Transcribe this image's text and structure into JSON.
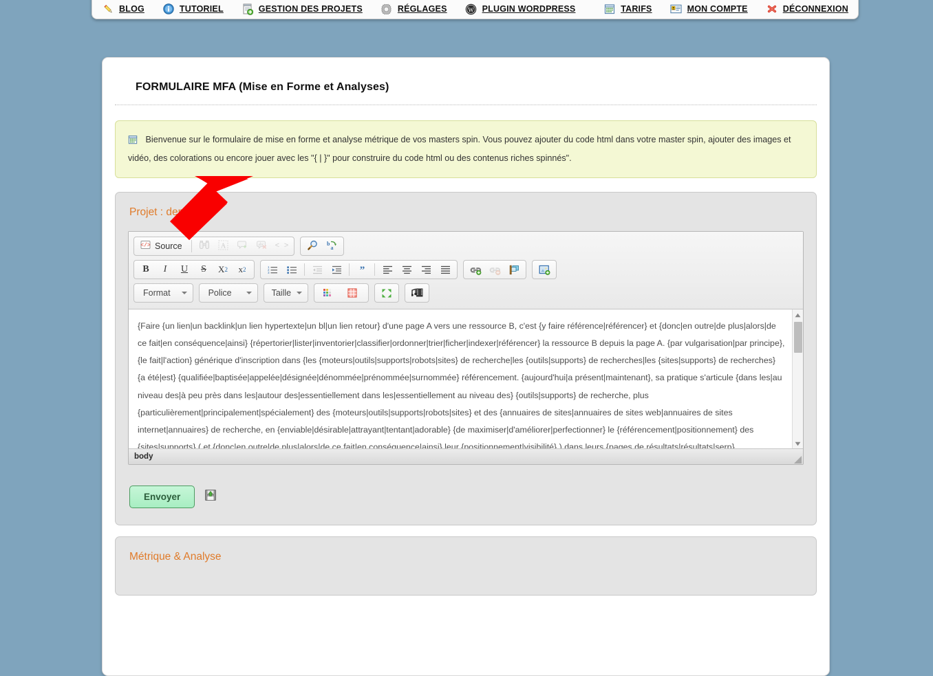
{
  "nav": {
    "left_items": [
      {
        "label": "BLOG",
        "icon": "pencil-icon"
      },
      {
        "label": "TUTORIEL",
        "icon": "info-circle-icon"
      },
      {
        "label": "GESTION DES PROJETS",
        "icon": "document-add-icon"
      },
      {
        "label": "RÉGLAGES",
        "icon": "gear-icon"
      },
      {
        "label": "PLUGIN WORDPRESS",
        "icon": "wordpress-icon"
      }
    ],
    "right_items": [
      {
        "label": "TARIFS",
        "icon": "calendar-icon"
      },
      {
        "label": "MON COMPTE",
        "icon": "id-card-icon"
      },
      {
        "label": "DÉCONNEXION",
        "icon": "red-x-icon"
      }
    ]
  },
  "page": {
    "title": "FORMULAIRE MFA (Mise en Forme et Analyses)",
    "notice": "Bienvenue sur le formulaire de mise en forme et analyse métrique de vos masters spin. Vous pouvez ajouter du code html dans votre master spin, ajouter des images et vidéo, des colorations ou encore jouer avec les \"{ | }\" pour construire du code html ou des contenus riches spinnés\".",
    "project_panel_title": "Projet : dem",
    "metrics_panel_title": "Métrique & Analyse"
  },
  "editor": {
    "toolbar_row1": [
      {
        "name": "source-button",
        "label": "Source",
        "icon": "source-code-icon",
        "disabled": false
      },
      {
        "name": "find-button",
        "label": "",
        "icon": "binoculars-icon",
        "disabled": true
      },
      {
        "name": "select-all-button",
        "label": "",
        "icon": "select-all-icon",
        "disabled": true
      },
      {
        "name": "spellcheck-button",
        "label": "",
        "icon": "spellcheck-icon",
        "disabled": true
      },
      {
        "name": "scayt-button",
        "label": "",
        "icon": "scayt-icon",
        "disabled": true
      },
      {
        "name": "show-blocks-button",
        "label": "< >",
        "icon": "show-blocks-icon",
        "disabled": true
      }
    ],
    "toolbar_row1b": [
      {
        "name": "search-button",
        "label": "",
        "icon": "magnifier-icon",
        "disabled": false
      },
      {
        "name": "replace-button",
        "label": "",
        "icon": "replace-abc-icon",
        "disabled": false
      }
    ],
    "toolbar_row2_text": [
      {
        "name": "bold-button",
        "label": "B",
        "icon": "bold-icon"
      },
      {
        "name": "italic-button",
        "label": "I",
        "icon": "italic-icon"
      },
      {
        "name": "underline-button",
        "label": "U",
        "icon": "underline-icon"
      },
      {
        "name": "strike-button",
        "label": "S",
        "icon": "strikethrough-icon"
      },
      {
        "name": "subscript-button",
        "label": "X",
        "icon": "subscript-icon"
      },
      {
        "name": "superscript-button",
        "label": "x",
        "icon": "superscript-icon"
      }
    ],
    "toolbar_row2_para": [
      {
        "name": "numbered-list-button",
        "icon": "numbered-list-icon",
        "disabled": false
      },
      {
        "name": "bulleted-list-button",
        "icon": "bulleted-list-icon",
        "disabled": false
      },
      {
        "name": "outdent-button",
        "icon": "outdent-icon",
        "disabled": true
      },
      {
        "name": "indent-button",
        "icon": "indent-icon",
        "disabled": false
      },
      {
        "name": "blockquote-button",
        "icon": "blockquote-icon",
        "disabled": false
      },
      {
        "name": "align-left-button",
        "icon": "align-left-icon",
        "disabled": false
      },
      {
        "name": "align-center-button",
        "icon": "align-center-icon",
        "disabled": false
      },
      {
        "name": "align-right-button",
        "icon": "align-right-icon",
        "disabled": false
      },
      {
        "name": "align-justify-button",
        "icon": "align-justify-icon",
        "disabled": false
      }
    ],
    "toolbar_row2_links": [
      {
        "name": "link-button",
        "icon": "link-add-icon",
        "disabled": false
      },
      {
        "name": "unlink-button",
        "icon": "link-remove-icon",
        "disabled": true
      },
      {
        "name": "anchor-button",
        "icon": "anchor-flag-icon",
        "disabled": false
      }
    ],
    "toolbar_row2_image": [
      {
        "name": "image-button",
        "icon": "image-add-icon",
        "disabled": false
      }
    ],
    "combos": [
      {
        "name": "format-select",
        "label": "Format"
      },
      {
        "name": "font-select",
        "label": "Police"
      },
      {
        "name": "size-select",
        "label": "Taille"
      }
    ],
    "toolbar_row3_extra": [
      {
        "name": "text-color-button",
        "icon": "text-color-palette-icon"
      },
      {
        "name": "background-color-button",
        "icon": "bg-color-grid-icon"
      },
      {
        "name": "maximize-button",
        "icon": "maximize-arrows-icon"
      },
      {
        "name": "media-embed-button",
        "icon": "media-embed-icon"
      }
    ],
    "content": "{Faire {un lien|un backlink|un lien hypertexte|un bl|un lien retour} d'une page A vers une ressource B, c'est {y faire référence|référencer} et {donc|en outre|de plus|alors|de ce fait|en conséquence|ainsi} {répertorier|lister|inventorier|classifier|ordonner|trier|ficher|indexer|référencer} la ressource B depuis la page A. {par vulgarisation|par principe}, {le fait|l'action} générique d'inscription dans {les {moteurs|outils|supports|robots|sites} de recherche|les {outils|supports} de recherches|les {sites|supports} de recherches} {a été|est} {qualifiée|baptisée|appelée|désignée|dénommée|prénommée|surnommée} référencement. {aujourd'hui|a présent|maintenant}, sa pratique s'articule {dans les|au niveau des|à peu près dans les|autour des|essentiellement dans les|essentiellement au niveau des} {outils|supports} de recherche, plus {particulièrement|principalement|spécialement} des {moteurs|outils|supports|robots|sites} et des {annuaires de sites|annuaires de sites web|annuaires de sites internet|annuaires} de recherche, en {enviable|désirable|attrayant|tentant|adorable} {de maximiser|d'améliorer|perfectionner} le {référencement|positionnement} des {sites|supports} ( et {donc|en outre|de plus|alors|de ce fait|en conséquence|ainsi} leur {positionnement|visibilité} ) dans leurs {pages de résultats|résultats|serp}, {appelées|baptisées|dénommées|désignées|nommées|surnommées|qualifiées}",
    "status_path": "body"
  },
  "form": {
    "submit_label": "Envoyer",
    "save_icon": "save-disk-icon"
  },
  "colors": {
    "page_bg": "#7fa4bd",
    "accent_orange": "#e07b2a",
    "notice_bg": "#f4f8d4",
    "notice_border": "#d7df9a",
    "panel_bg": "#e4e4e4",
    "submit_bg": "#b7f2cd",
    "arrow_red": "#f90000"
  }
}
